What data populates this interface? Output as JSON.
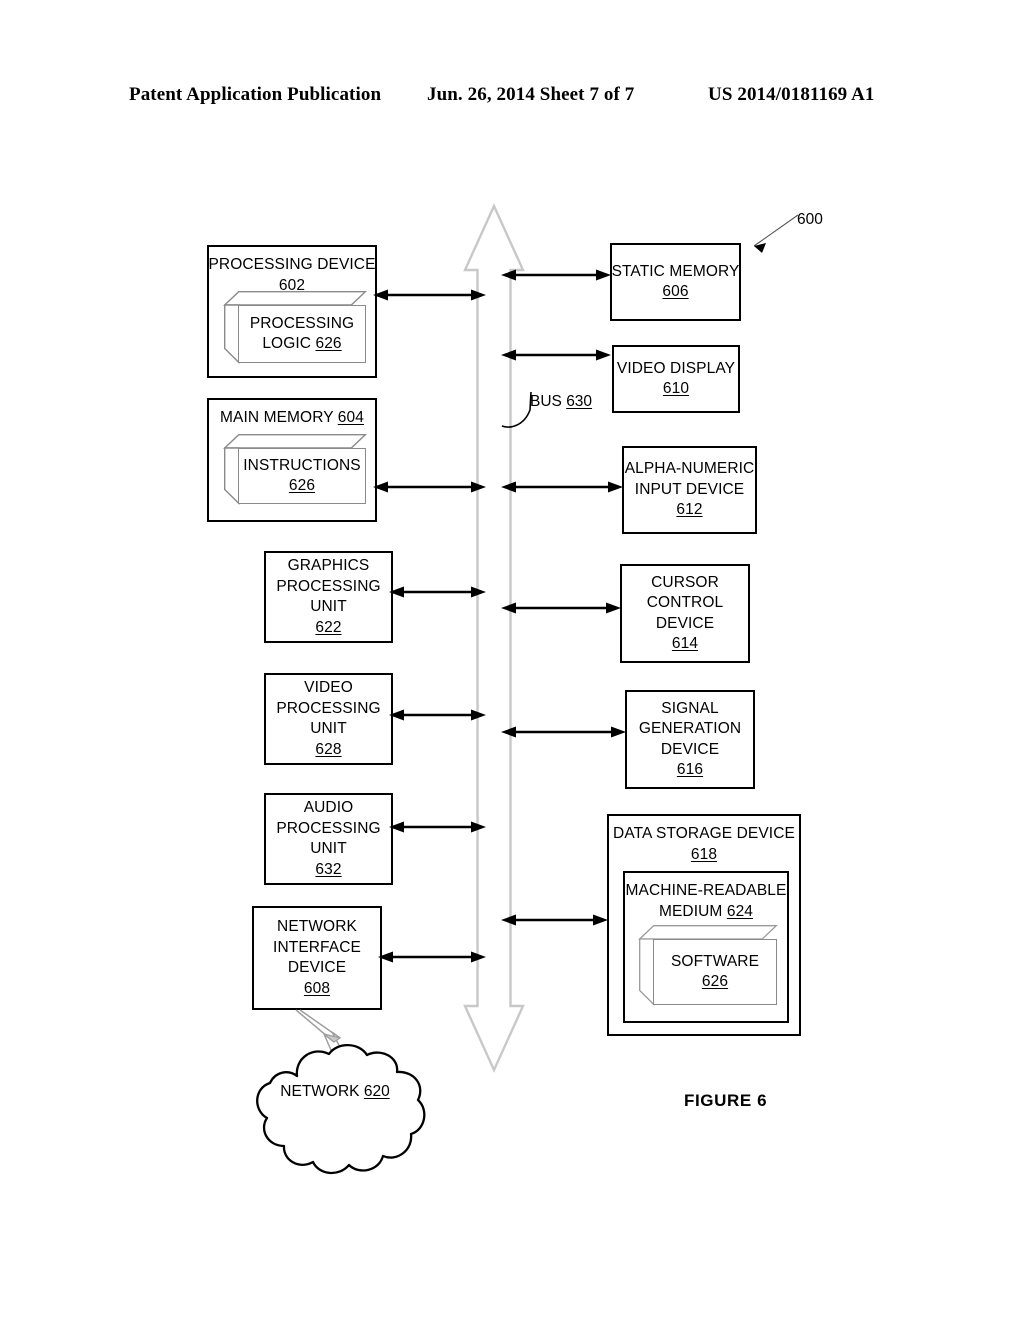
{
  "header": {
    "publication": "Patent Application Publication",
    "date_sheet": "Jun. 26, 2014  Sheet 7 of 7",
    "patent_number": "US 2014/0181169 A1"
  },
  "figure": {
    "caption": "FIGURE 6",
    "system_ref": "600"
  },
  "bus": {
    "label": "BUS",
    "number": "630"
  },
  "left_column": [
    {
      "id": "processing-device",
      "title": "PROCESSING DEVICE",
      "number": "602",
      "inner": {
        "id": "processing-logic",
        "line1": "PROCESSING",
        "line2": "LOGIC",
        "number": "626"
      }
    },
    {
      "id": "main-memory",
      "title": "MAIN MEMORY",
      "number": "604",
      "inner": {
        "id": "instructions",
        "line1": "INSTRUCTIONS",
        "number": "626"
      }
    },
    {
      "id": "graphics-processing-unit",
      "lines": [
        "GRAPHICS",
        "PROCESSING",
        "UNIT"
      ],
      "number": "622"
    },
    {
      "id": "video-processing-unit",
      "lines": [
        "VIDEO",
        "PROCESSING",
        "UNIT"
      ],
      "number": "628"
    },
    {
      "id": "audio-processing-unit",
      "lines": [
        "AUDIO",
        "PROCESSING",
        "UNIT"
      ],
      "number": "632"
    },
    {
      "id": "network-interface-device",
      "lines": [
        "NETWORK",
        "INTERFACE",
        "DEVICE"
      ],
      "number": "608"
    }
  ],
  "right_column": [
    {
      "id": "static-memory",
      "lines": [
        "STATIC MEMORY"
      ],
      "number": "606"
    },
    {
      "id": "video-display",
      "lines": [
        "VIDEO DISPLAY"
      ],
      "number": "610"
    },
    {
      "id": "alpha-numeric-input-device",
      "lines": [
        "ALPHA-NUMERIC",
        "INPUT DEVICE"
      ],
      "number": "612"
    },
    {
      "id": "cursor-control-device",
      "lines": [
        "CURSOR",
        "CONTROL",
        "DEVICE"
      ],
      "number": "614"
    },
    {
      "id": "signal-generation-device",
      "lines": [
        "SIGNAL",
        "GENERATION",
        "DEVICE"
      ],
      "number": "616"
    }
  ],
  "data_storage": {
    "title": "DATA STORAGE DEVICE",
    "number": "618",
    "medium": {
      "line1": "MACHINE-READABLE",
      "line2": "MEDIUM",
      "number": "624"
    },
    "software": {
      "label": "SOFTWARE",
      "number": "626"
    }
  },
  "network": {
    "label": "NETWORK",
    "number": "620"
  }
}
